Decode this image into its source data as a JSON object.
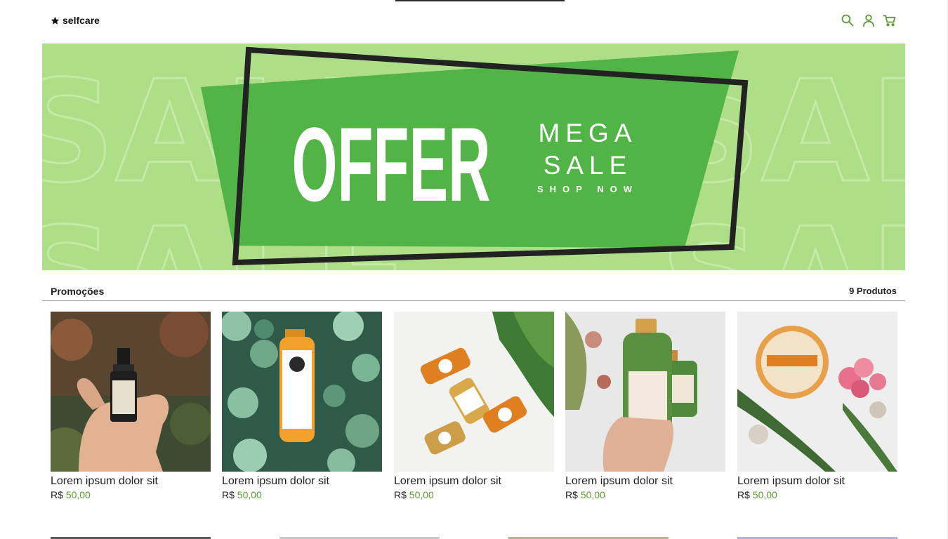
{
  "header": {
    "logo_text": "selfcare",
    "icons": [
      "search-icon",
      "user-icon",
      "cart-icon"
    ],
    "accent_color": "#5f9a33"
  },
  "banner": {
    "headline": "OFFER",
    "line1": "MEGA",
    "line2": "SALE",
    "cta": "SHOP NOW",
    "watermark": "SALE",
    "bg_color": "#aede88",
    "shape_color": "#52b347",
    "frame_color": "#222222"
  },
  "section": {
    "title": "Promoções",
    "count": "9 Produtos"
  },
  "products": [
    {
      "name": "Lorem ipsum dolor sit",
      "currency": "R$",
      "price": "50,00",
      "image": "serum-bottle-in-hand"
    },
    {
      "name": "Lorem ipsum dolor sit",
      "currency": "R$",
      "price": "50,00",
      "image": "vitality-shot-on-leaves"
    },
    {
      "name": "Lorem ipsum dolor sit",
      "currency": "R$",
      "price": "50,00",
      "image": "juice-bottles-flatlay"
    },
    {
      "name": "Lorem ipsum dolor sit",
      "currency": "R$",
      "price": "50,00",
      "image": "maui-shampoo-in-hand"
    },
    {
      "name": "Lorem ipsum dolor sit",
      "currency": "R$",
      "price": "50,00",
      "image": "airspun-powder-with-flowers"
    }
  ]
}
